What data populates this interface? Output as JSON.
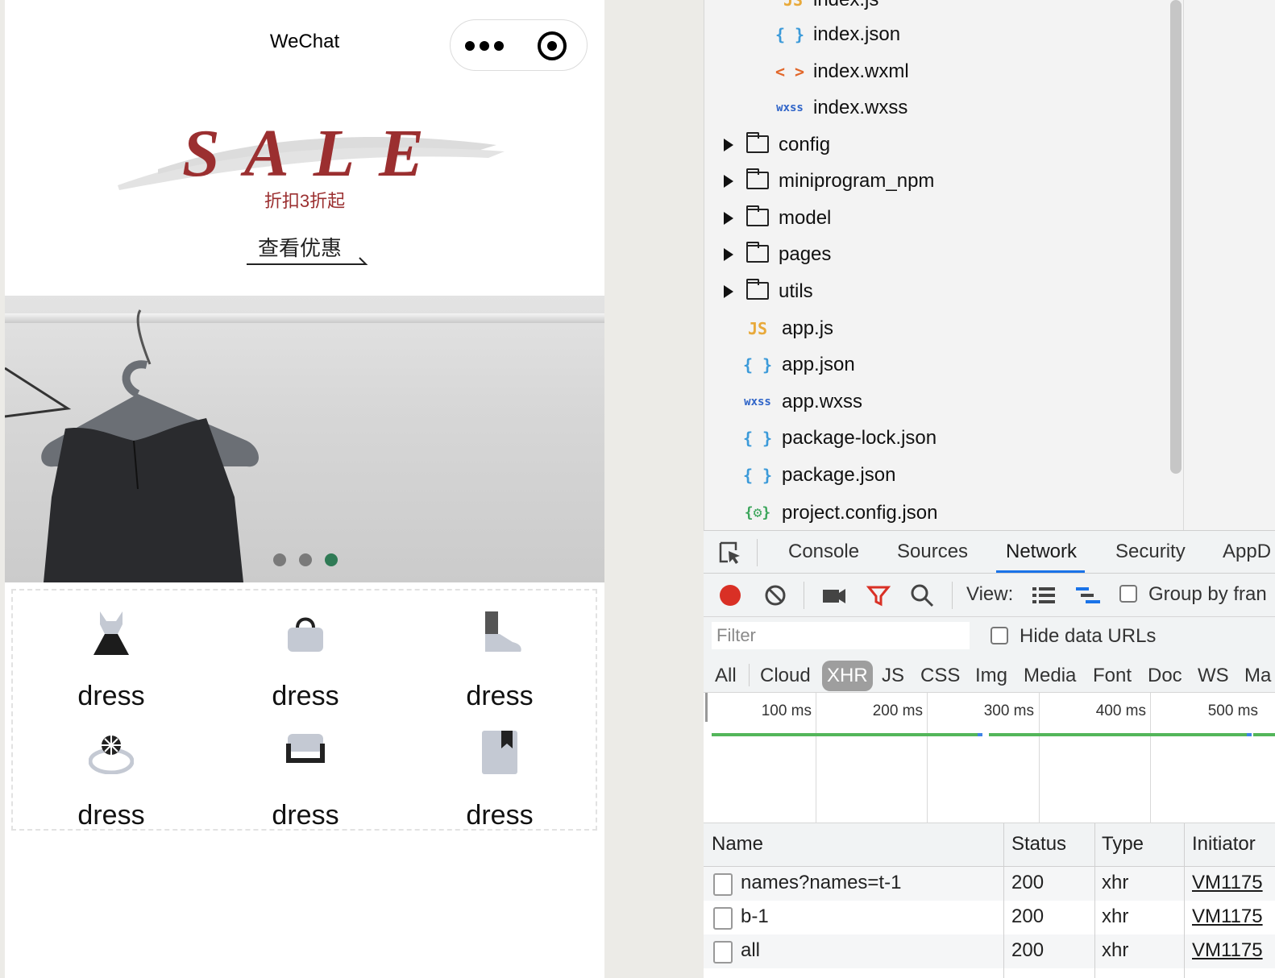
{
  "phone": {
    "title": "WeChat",
    "sale": {
      "headline": "SALE",
      "subtitle": "折扣3折起",
      "cta": "查看优惠"
    },
    "banner": {
      "active_dot": 3,
      "dot_count": 3,
      "colors": {
        "dot": "#7a7a7a",
        "dot_active": "#2f7a55"
      }
    },
    "categories": [
      {
        "label": "dress",
        "icon": "dress-icon"
      },
      {
        "label": "dress",
        "icon": "handbag-icon"
      },
      {
        "label": "dress",
        "icon": "sneaker-icon"
      },
      {
        "label": "dress",
        "icon": "ring-icon"
      },
      {
        "label": "dress",
        "icon": "sofa-icon"
      },
      {
        "label": "dress",
        "icon": "book-icon"
      }
    ]
  },
  "file_tree": {
    "items": [
      {
        "name": "index.js",
        "kind": "js"
      },
      {
        "name": "index.json",
        "kind": "json"
      },
      {
        "name": "index.wxml",
        "kind": "wxml"
      },
      {
        "name": "index.wxss",
        "kind": "wxss"
      },
      {
        "name": "config",
        "kind": "folder"
      },
      {
        "name": "miniprogram_npm",
        "kind": "folder"
      },
      {
        "name": "model",
        "kind": "folder"
      },
      {
        "name": "pages",
        "kind": "folder"
      },
      {
        "name": "utils",
        "kind": "folder"
      },
      {
        "name": "app.js",
        "kind": "js"
      },
      {
        "name": "app.json",
        "kind": "json"
      },
      {
        "name": "app.wxss",
        "kind": "wxss"
      },
      {
        "name": "package-lock.json",
        "kind": "json"
      },
      {
        "name": "package.json",
        "kind": "json"
      },
      {
        "name": "project.config.json",
        "kind": "config"
      }
    ],
    "icon_glyphs": {
      "js": "JS",
      "json": "{ }",
      "wxml": "< >",
      "wxss": "wxss",
      "config": "{⚙}"
    },
    "icon_colors": {
      "js": "#e8a93a",
      "json": "#3b9ad9",
      "wxml": "#e2672a",
      "wxss": "#2f64c8",
      "config": "#3aa55a"
    }
  },
  "devtools": {
    "tabs": [
      "Console",
      "Sources",
      "Network",
      "Security",
      "AppD"
    ],
    "active_tab": "Network",
    "toolbar": {
      "view_label": "View:",
      "group_by_frame": "Group by fran"
    },
    "filter": {
      "placeholder": "Filter",
      "hide_data_urls": "Hide data URLs"
    },
    "types": [
      "All",
      "Cloud",
      "XHR",
      "JS",
      "CSS",
      "Img",
      "Media",
      "Font",
      "Doc",
      "WS",
      "Ma"
    ],
    "active_type": "XHR",
    "timeline": {
      "labels": [
        "100 ms",
        "200 ms",
        "300 ms",
        "400 ms",
        "500 ms"
      ]
    },
    "table": {
      "columns": [
        "Name",
        "Status",
        "Type",
        "Initiator"
      ],
      "rows": [
        {
          "name": "names?names=t-1",
          "status": "200",
          "type": "xhr",
          "initiator": "VM1175"
        },
        {
          "name": "b-1",
          "status": "200",
          "type": "xhr",
          "initiator": "VM1175"
        },
        {
          "name": "all",
          "status": "200",
          "type": "xhr",
          "initiator": "VM1175"
        }
      ]
    },
    "colors": {
      "record": "#d93025",
      "filter_active": "#d93025",
      "tab_underline": "#1a73e8"
    }
  }
}
